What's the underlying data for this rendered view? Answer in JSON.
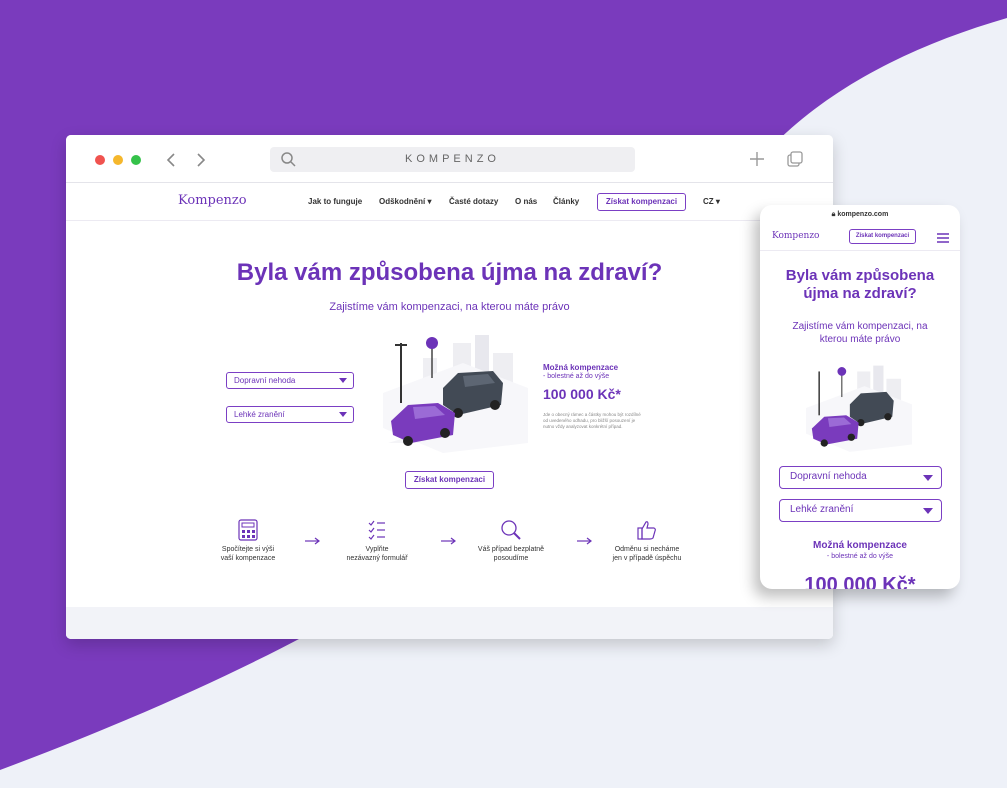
{
  "colors": {
    "brand": "#6c33b8",
    "background_purple": "#7a3bbd",
    "background_light": "#eef1f8"
  },
  "browser": {
    "url_text": "KOMPENZO",
    "icons": [
      "close-dot",
      "minimize-dot",
      "maximize-dot",
      "back-icon",
      "forward-icon",
      "search-icon",
      "plus-icon",
      "tabs-icon"
    ]
  },
  "site": {
    "logo": "Kompenzo",
    "nav": {
      "how_it_works": "Jak to funguje",
      "compensation": "Odškodnění",
      "faq": "Časté dotazy",
      "about": "O nás",
      "articles": "Články",
      "cta": "Získat kompenzaci",
      "language": "CZ"
    },
    "hero": {
      "title": "Byla vám způsobena újma na zdraví?",
      "subtitle": "Zajistíme vám kompenzaci, na kterou máte právo",
      "select_type": "Dopravní nehoda",
      "select_injury": "Lehké zranění",
      "possible_label": "Možná kompenzace",
      "possible_sub": "- bolestné až do výše",
      "amount": "100 000 Kč*",
      "note": "Jde o obecný rámec a částky mohou být rozdílné od uvedeného odhadu, pro bližší posouzení je nutno vždy analyzovat konkrétní případ.",
      "cta": "Získat kompenzaci"
    },
    "steps": [
      {
        "label": "Spočítejte si výši\nvaší kompenzace",
        "icon": "calculator-icon"
      },
      {
        "label": "Vyplňte\nnezávazný formulář",
        "icon": "checklist-icon"
      },
      {
        "label": "Váš případ bezplatně\nposoudíme",
        "icon": "magnifier-icon"
      },
      {
        "label": "Odměnu si necháme\njen v případě úspěchu",
        "icon": "thumbs-up-icon"
      }
    ]
  },
  "phone": {
    "url": "kompenzo.com",
    "logo": "Kompenzo",
    "cta": "Získat kompenzaci",
    "title": "Byla vám způsobena újma na zdraví?",
    "subtitle": "Zajistíme vám kompenzaci, na kterou máte právo",
    "select_type": "Dopravní nehoda",
    "select_injury": "Lehké zranění",
    "possible_label": "Možná kompenzace",
    "possible_sub": "- bolestné až do výše",
    "amount": "100 000 Kč*"
  }
}
